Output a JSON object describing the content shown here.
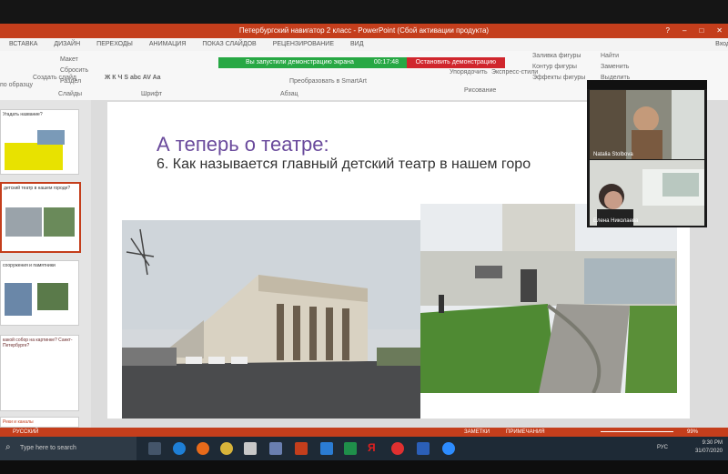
{
  "window": {
    "title": "Петербургский навигатор 2 класс - PowerPoint (Сбой активации продукта)",
    "signin": "Вход"
  },
  "ribbon": {
    "tabs": [
      "ВСТАВКА",
      "ДИЗАЙН",
      "ПЕРЕХОДЫ",
      "АНИМАЦИЯ",
      "ПОКАЗ СЛАЙДОВ",
      "РЕЦЕНЗИРОВАНИЕ",
      "ВИД"
    ],
    "clipboard": {
      "layout": "Макет",
      "reset": "Сбросить",
      "section": "Раздел",
      "create_slide": "Создать слайд",
      "by_sample": "по образцу"
    },
    "groups": {
      "slides": "Слайды",
      "font": "Шрифт",
      "paragraph": "Абзац",
      "drawing": "Рисование"
    },
    "font_buttons": "Ж К Ч S abc AV Aa",
    "smartart": "Преобразовать в SmartArt",
    "arrange": "Упорядочить",
    "express": "Экспресс-стили",
    "shape_fill": "Заливка фигуры",
    "shape_outline": "Контур фигуры",
    "shape_effects": "Эффекты фигуры",
    "find": "Найти",
    "replace": "Заменить",
    "select": "Выделить"
  },
  "share_bar": {
    "message": "Вы запустили демонстрацию экрана",
    "time": "00:17:48",
    "stop": "Остановить демонстрацию"
  },
  "slide": {
    "title": "А теперь о театре:",
    "question": "6. Как называется главный детский театр в нашем горо"
  },
  "thumbnails": [
    {
      "text": "Угадать название?",
      "color": "#e8e200"
    },
    {
      "text": "детский театр в нашем городе?",
      "color": "#ffffff"
    },
    {
      "text": "сооружения и памятники",
      "color": "#ffffff"
    },
    {
      "text": "какой собор на картинке? Санкт-Петербурге?",
      "color": "#ffffff"
    },
    {
      "text": "Реки и каналы",
      "color": "#ffffff"
    }
  ],
  "participants": [
    {
      "name": "Natalia Stolbova"
    },
    {
      "name": "Елена Николаева"
    }
  ],
  "statusbar": {
    "language": "РУССКИЙ",
    "notes": "ЗАМЕТКИ",
    "comments": "ПРИМЕЧАНИЯ",
    "zoom": "99%"
  },
  "taskbar": {
    "search_placeholder": "Type here to search",
    "lang": "РУС",
    "time": "9:30 PM",
    "date": "31/07/2020",
    "icons": [
      "edge-icon",
      "firefox-icon",
      "chrome-icon",
      "store-icon",
      "powerpoint-icon",
      "mail-icon",
      "excel-icon",
      "yandex-icon",
      "yandex-browser-icon",
      "word-icon",
      "zoom-icon"
    ]
  },
  "colors": {
    "ppt_accent": "#c43e1c",
    "share_green": "#27a844",
    "share_red": "#d0262d",
    "title_purple": "#6a4a9c"
  }
}
